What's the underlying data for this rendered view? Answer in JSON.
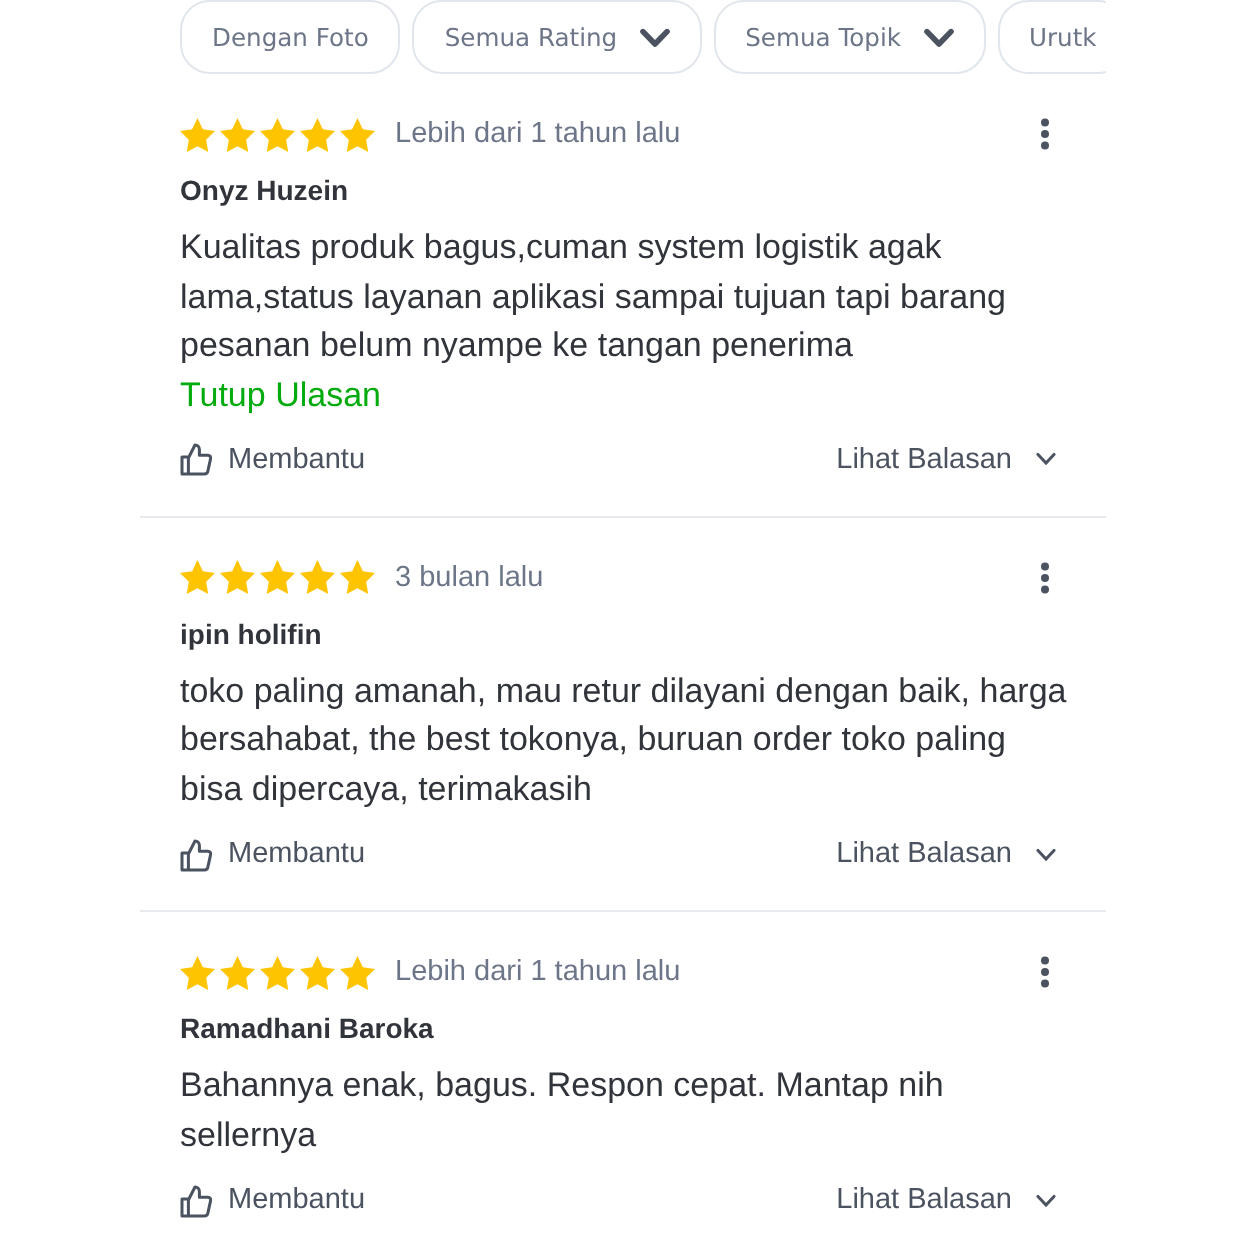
{
  "filters": [
    {
      "label": "Dengan Foto",
      "kind": "toggle"
    },
    {
      "label": "Semua Rating",
      "kind": "dropdown"
    },
    {
      "label": "Semua Topik",
      "kind": "dropdown"
    },
    {
      "label": "Urutk",
      "kind": "toggle"
    }
  ],
  "reviews": [
    {
      "stars": 5,
      "time": "Lebih dari 1 tahun lalu",
      "name": "Onyz Huzein",
      "text": "Kualitas produk bagus,cuman system logistik agak lama,status layanan aplikasi sampai tujuan tapi barang pesanan belum nyampe ke tangan penerima",
      "toggle_link": "Tutup Ulasan",
      "helpful": "Membantu",
      "replies": "Lihat Balasan"
    },
    {
      "stars": 5,
      "time": "3 bulan lalu",
      "name": "ipin holifin",
      "text": "toko paling amanah, mau retur dilayani dengan baik, harga bersahabat, the best tokonya, buruan order toko paling bisa dipercaya, terimakasih",
      "helpful": "Membantu",
      "replies": "Lihat Balasan"
    },
    {
      "stars": 5,
      "time": "Lebih dari 1 tahun lalu",
      "name": "Ramadhani Baroka",
      "text": "Bahannya enak, bagus. Respon cepat. Mantap nih sellernya",
      "helpful": "Membantu",
      "replies": "Lihat Balasan"
    }
  ]
}
